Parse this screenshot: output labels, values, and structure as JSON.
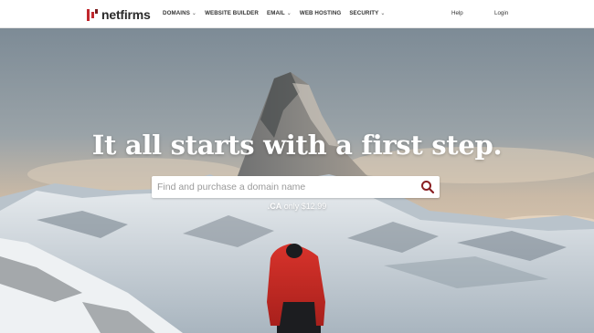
{
  "brand": {
    "name": "netfirms"
  },
  "nav": {
    "items": [
      {
        "label": "DOMAINS",
        "has_dropdown": true
      },
      {
        "label": "WEBSITE BUILDER",
        "has_dropdown": false
      },
      {
        "label": "EMAIL",
        "has_dropdown": true
      },
      {
        "label": "WEB HOSTING",
        "has_dropdown": false
      },
      {
        "label": "SECURITY",
        "has_dropdown": true
      }
    ],
    "help_label": "Help",
    "login_label": "Login"
  },
  "hero": {
    "headline": "It all starts with a first step.",
    "search_placeholder": "Find and purchase a domain name",
    "search_value": "",
    "promo_tld": ".CA",
    "promo_text": "only $12.99"
  },
  "colors": {
    "brand_red": "#c1272d",
    "search_icon": "#8a1f22"
  },
  "icons": {
    "search": "search-icon",
    "caret": "chevron-down-icon"
  }
}
